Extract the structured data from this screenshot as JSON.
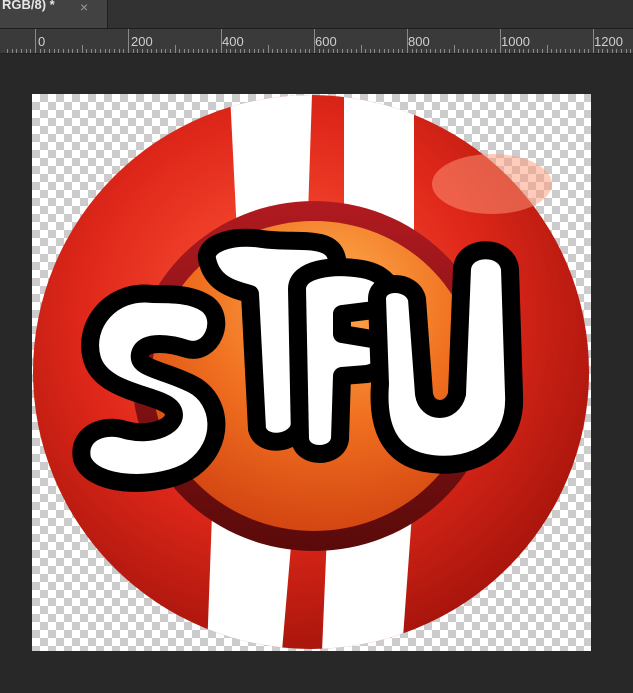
{
  "tab": {
    "title": "RGB/8) *",
    "close_glyph": "×"
  },
  "ruler": {
    "labels": [
      "0",
      "200",
      "400",
      "600",
      "800",
      "1000",
      "1200"
    ]
  },
  "logo": {
    "text": "STFU",
    "icon": "stfu-badge-logo",
    "colors": {
      "red": "#e0281a",
      "orange": "#f07020",
      "stripe": "#ffffff",
      "outline": "#000000"
    }
  }
}
